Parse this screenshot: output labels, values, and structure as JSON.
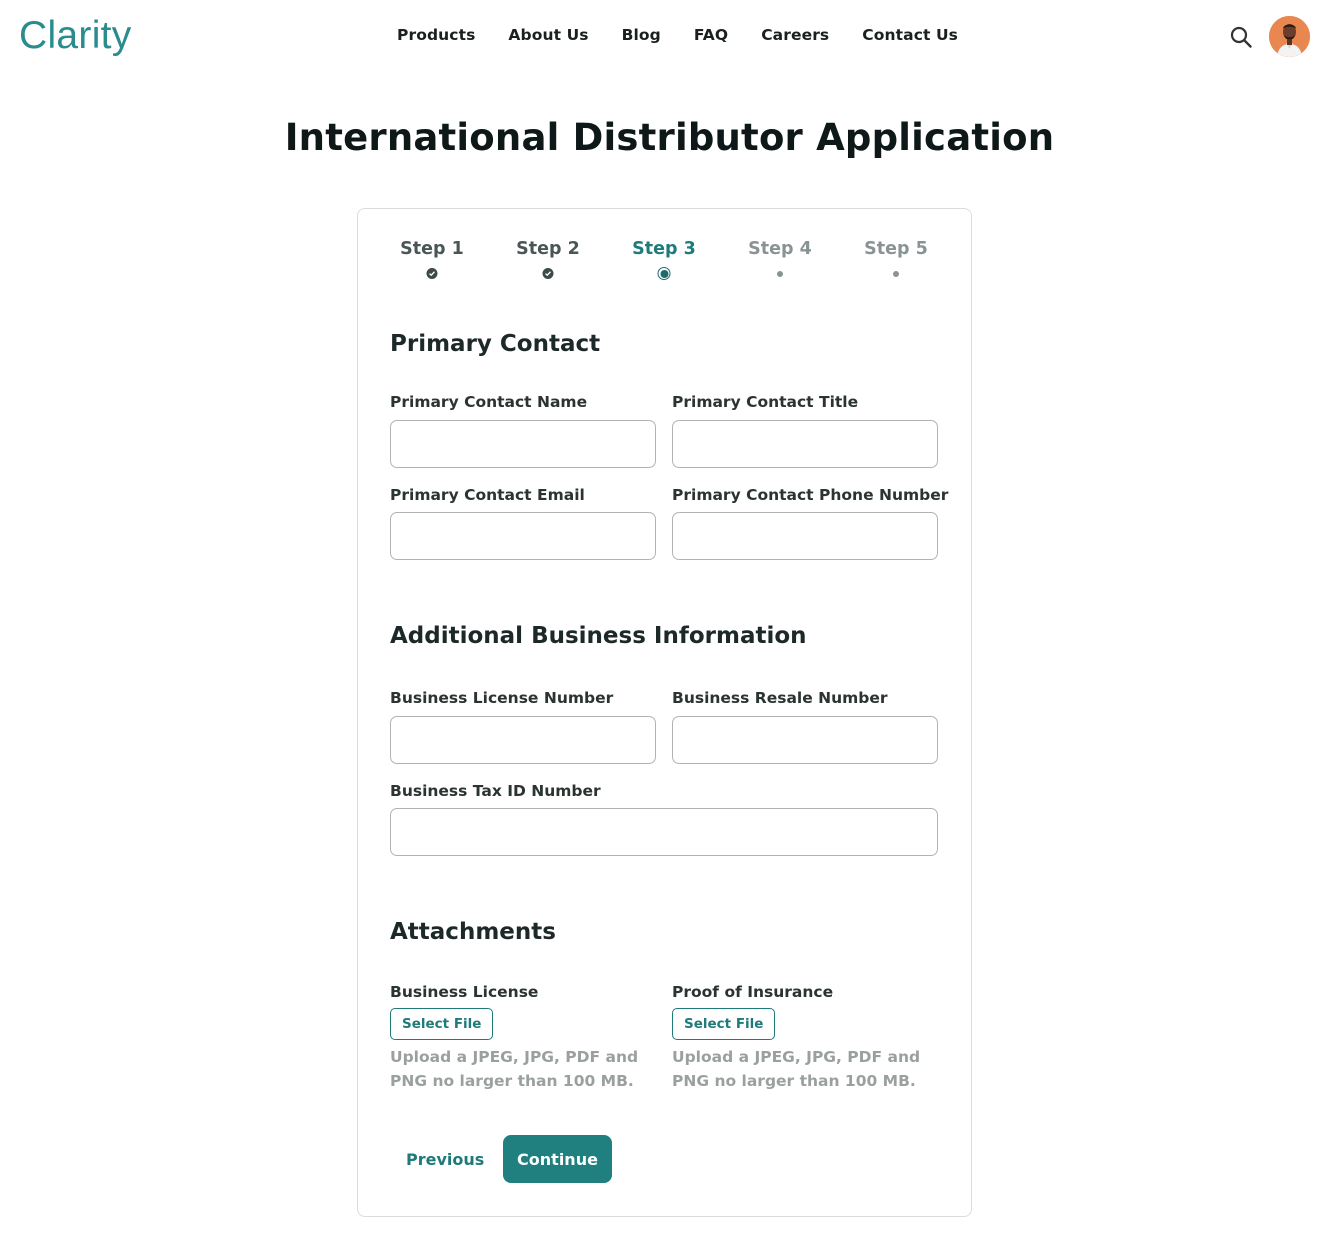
{
  "header": {
    "logo": "Clarity",
    "nav": [
      "Products",
      "About Us",
      "Blog",
      "FAQ",
      "Careers",
      "Contact Us"
    ],
    "icons": {
      "search": "search-icon",
      "avatar": "user-avatar"
    }
  },
  "page": {
    "title": "International Distributor Application"
  },
  "stepper": {
    "steps": [
      {
        "label": "Step 1",
        "state": "complete"
      },
      {
        "label": "Step 2",
        "state": "complete"
      },
      {
        "label": "Step 3",
        "state": "active"
      },
      {
        "label": "Step 4",
        "state": "upcoming"
      },
      {
        "label": "Step 5",
        "state": "upcoming"
      }
    ]
  },
  "primary_contact": {
    "title": "Primary Contact",
    "name_label": "Primary Contact Name",
    "name_value": "",
    "title_label": "Primary Contact Title",
    "title_value": "",
    "email_label": "Primary Contact Email",
    "email_value": "",
    "phone_label": "Primary Contact Phone Number",
    "phone_value": ""
  },
  "business_info": {
    "title": "Additional Business Information",
    "license_label": "Business License Number",
    "license_value": "",
    "resale_label": "Business Resale Number",
    "resale_value": "",
    "tax_label": "Business Tax ID Number",
    "tax_value": ""
  },
  "attachments": {
    "title": "Attachments",
    "items": [
      {
        "label": "Business License",
        "button": "Select File",
        "hint": "Upload a JPEG, JPG, PDF and PNG no larger than 100 MB."
      },
      {
        "label": "Proof of Insurance",
        "button": "Select File",
        "hint": "Upload a JPEG, JPG, PDF and PNG no larger than 100 MB."
      }
    ]
  },
  "actions": {
    "previous": "Previous",
    "continue": "Continue"
  },
  "colors": {
    "brand": "#2a8c8c",
    "primary_button": "#207f7f",
    "text": "#1d2828",
    "muted": "#9aa0a0"
  }
}
